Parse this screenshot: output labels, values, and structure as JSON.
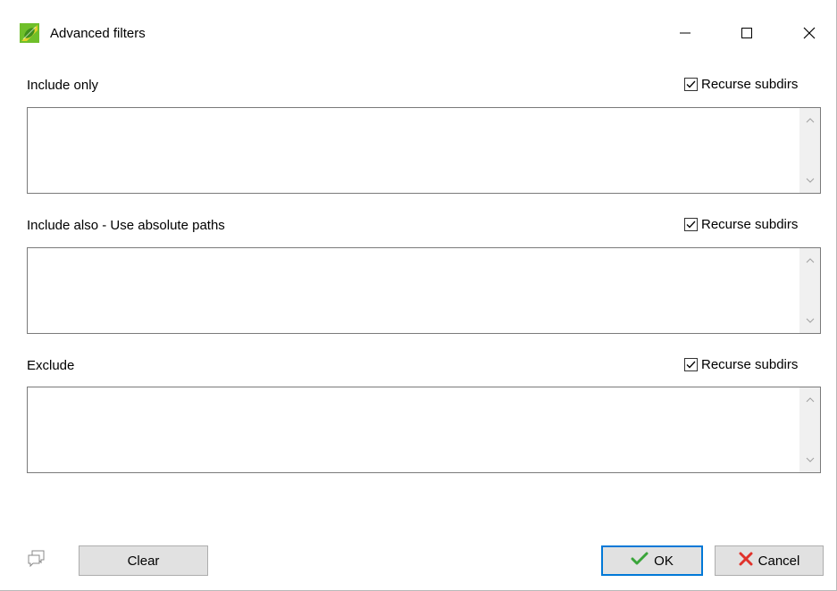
{
  "window": {
    "title": "Advanced filters",
    "controls": [
      "minimize",
      "maximize",
      "close"
    ]
  },
  "sections": [
    {
      "label": "Include only",
      "checkbox_label": "Recurse subdirs",
      "checked": true,
      "value": ""
    },
    {
      "label": "Include also - Use absolute paths",
      "checkbox_label": "Recurse subdirs",
      "checked": true,
      "value": ""
    },
    {
      "label": "Exclude",
      "checkbox_label": "Recurse subdirs",
      "checked": true,
      "value": ""
    }
  ],
  "footer": {
    "clear_label": "Clear",
    "ok_label": "OK",
    "cancel_label": "Cancel"
  },
  "icons": {
    "app": "leaf-app-icon",
    "comment": "speech-bubbles-icon",
    "ok": "checkmark-icon",
    "cancel": "x-icon"
  },
  "colors": {
    "ok_accent": "#0078d7",
    "ok_check": "#3aa53a",
    "cancel_x": "#e0322b",
    "app_icon_green": "#6fbf2a",
    "app_icon_yellow": "#e3d12a"
  }
}
